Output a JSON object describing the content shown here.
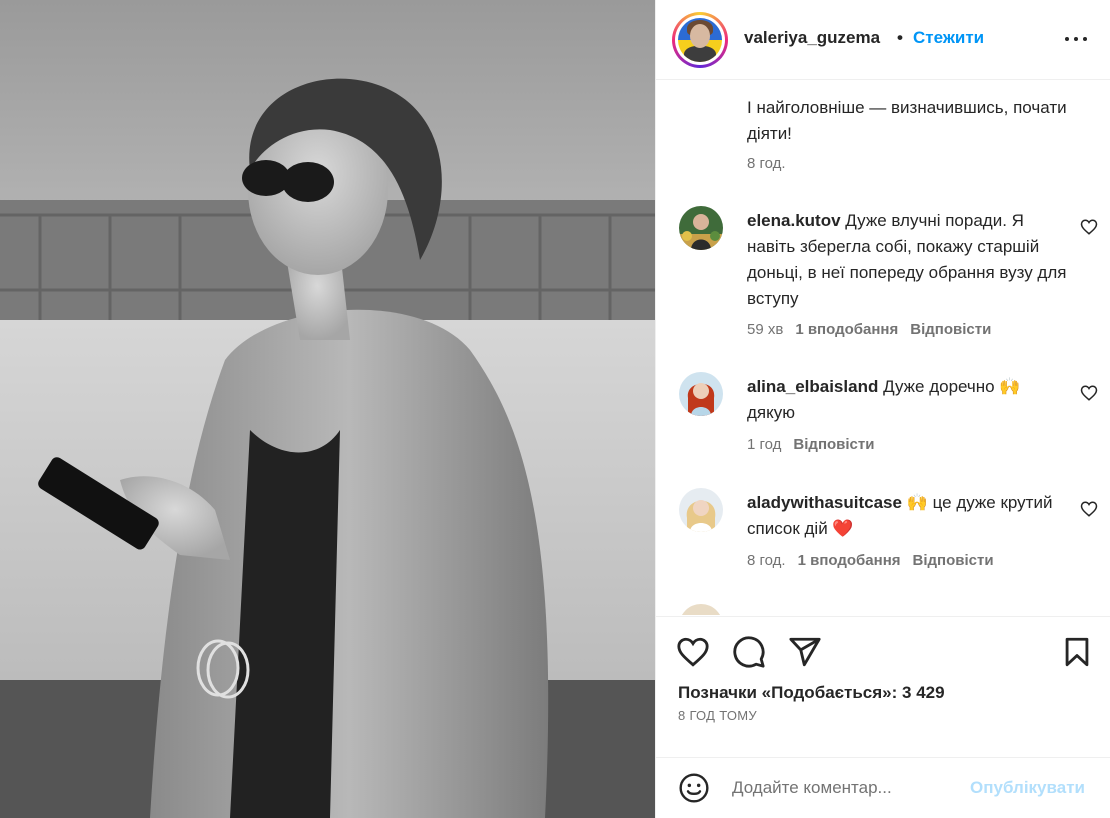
{
  "photo": {
    "alt": "Woman in sunglasses holding a phone",
    "icon": "photo"
  },
  "header": {
    "username": "valeriya_guzema",
    "separator": "•",
    "follow_label": "Стежити",
    "more_icon": "more-dots-icon"
  },
  "caption": {
    "text": "І найголовніше — визначившись, почати діяти!",
    "time": "8 год."
  },
  "comments": [
    {
      "username": "elena.kutov",
      "text": "Дуже влучні поради. Я навіть зберегла собі, покажу старшій доньці, в неї попереду обрання вузу для вступу",
      "time": "59 хв",
      "likes": "1 вподобання",
      "reply": "Відповісти"
    },
    {
      "username": "alina_elbaisland",
      "text": "Дуже доречно 🙌 дякую",
      "time": "1 год",
      "likes": "",
      "reply": "Відповісти"
    },
    {
      "username": "aladywithasuitcase",
      "text": "🙌 це дуже крутий список дій ❤️",
      "time": "8 год.",
      "likes": "1 вподобання",
      "reply": "Відповісти"
    }
  ],
  "actions": {
    "like_icon": "heart-icon",
    "comment_icon": "comment-icon",
    "share_icon": "share-icon",
    "save_icon": "bookmark-icon"
  },
  "likes_line": "Позначки «Подобається»: 3 429",
  "post_time": "8 ГОД ТОМУ",
  "composer": {
    "placeholder": "Додайте коментар...",
    "publish_label": "Опублікувати"
  },
  "colors": {
    "accent": "#0095f6",
    "publish_disabled": "#b2dffc",
    "muted": "#737373",
    "text": "#262626"
  }
}
